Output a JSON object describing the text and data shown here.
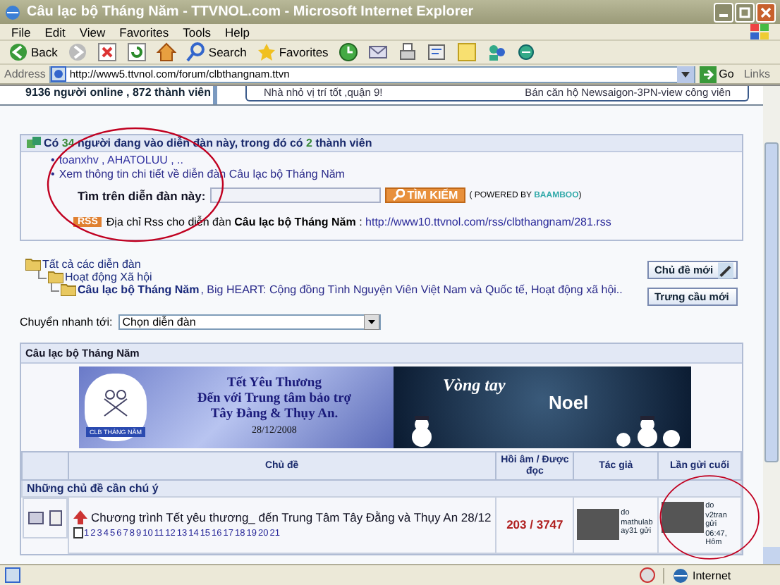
{
  "window": {
    "title": "Câu lạc bộ Tháng Năm - TTVNOL.com - Microsoft Internet Explorer"
  },
  "menu": [
    "File",
    "Edit",
    "View",
    "Favorites",
    "Tools",
    "Help"
  ],
  "toolbar": [
    {
      "kind": "back",
      "label": "Back"
    },
    {
      "kind": "forward"
    },
    {
      "kind": "stop"
    },
    {
      "kind": "refresh"
    },
    {
      "kind": "home"
    },
    {
      "kind": "search",
      "label": "Search"
    },
    {
      "kind": "favorites",
      "label": "Favorites"
    },
    {
      "kind": "history"
    },
    {
      "kind": "mail"
    },
    {
      "kind": "print"
    },
    {
      "kind": "edit"
    },
    {
      "kind": "note"
    },
    {
      "kind": "messenger"
    },
    {
      "kind": "research"
    }
  ],
  "address": {
    "label": "Address",
    "value": "http://www5.ttvnol.com/forum/clbthangnam.ttvn",
    "go": "Go",
    "links": "Links"
  },
  "top_strip": {
    "online": "9136 người online , 872 thành viên",
    "ads": [
      "Nhà nhỏ vị trí tốt ,quận 9!",
      "Bán căn hộ Newsaigon-3PN-view công viên"
    ]
  },
  "online_box": {
    "parts": [
      "Có ",
      "34",
      " người đang vào diễn đàn này, trong đó có ",
      "2",
      " thành viên"
    ],
    "bullet": "•",
    "users": "toanxhv , AHATOLUU , ..",
    "info_link": "Xem thông tin chi tiết về diễn đàn Câu lạc bộ Tháng Năm",
    "search_label": "Tìm trên diễn đàn này:",
    "search_button": "TÌM KIẾM",
    "powered": "( POWERED BY ",
    "powered_brand": "BAAMBOO",
    "powered_end": ")",
    "rss_badge": "RSS",
    "rss_text": "Địa chỉ Rss cho diễn đàn **Câu lạc bộ Tháng Năm** : ",
    "rss_link": "http://www10.ttvnol.com/rss/clbthangnam/281.rss"
  },
  "breadcrumbs": [
    {
      "label": "Tất cả các diễn đàn",
      "children": [
        {
          "label": "Hoạt động Xã hội",
          "children": [
            {
              "label": "Câu lạc bộ Tháng Năm",
              "suffix": ", Big HEART: Cộng đồng Tình Nguyện Viên Việt Nam và Quốc tế, Hoạt động xã hội.."
            }
          ]
        }
      ]
    }
  ],
  "actions": [
    {
      "kind": "new-topic",
      "label": "Chủ đề mới"
    },
    {
      "kind": "poll",
      "label": "Trưng cầu mới"
    }
  ],
  "jump": {
    "label": "Chuyển nhanh tới:",
    "value": "Chọn diễn đàn"
  },
  "forum": {
    "title": "Câu lạc bộ Tháng Năm",
    "banner_left": {
      "logo": "CLB THÁNG NĂM",
      "lines": [
        "Tết Yêu Thương",
        "Đến với Trung tâm bảo trợ",
        "Tây Đằng & Thụy An.",
        "28/12/2008"
      ]
    },
    "banner_right": {
      "script": "Vòng tay",
      "word": "Noel"
    },
    "columns": [
      "Chủ đề",
      "Hồi âm / Được đọc",
      "Tác giả",
      "Lần gửi cuối"
    ],
    "section": "Những chủ đề cần chú ý",
    "rows": [
      {
        "title": "Chương trình Tết yêu thương_ đến Trung Tâm Tây Đằng và Thụy An 28/12",
        "pages": [
          "1",
          "2",
          "3",
          "4",
          "5",
          "6",
          "7",
          "8",
          "9",
          "10",
          "11",
          "12",
          "13",
          "14",
          "15",
          "16",
          "17",
          "18",
          "19",
          "20",
          "21"
        ],
        "replies": "203 / 3747",
        "author": "do mathulabay31 gửi",
        "last": "do v2tran gửi 06:47, Hôm"
      }
    ]
  },
  "status": {
    "zone": "Internet"
  }
}
